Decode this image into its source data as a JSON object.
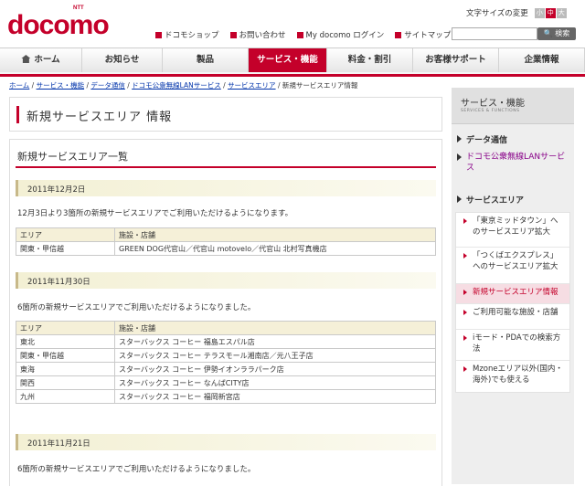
{
  "header": {
    "logo_small": "NTT",
    "logo_text": "docomo",
    "utility_links": [
      "ドコモショップ",
      "お問い合わせ",
      "My docomo ログイン",
      "サイトマップ"
    ],
    "font_size_label": "文字サイズの変更",
    "font_sizes": [
      "小",
      "中",
      "大"
    ],
    "search_placeholder": "",
    "search_button": "検索"
  },
  "nav": {
    "tabs": [
      "ホーム",
      "お知らせ",
      "製品",
      "サービス・機能",
      "料金・割引",
      "お客様サポート",
      "企業情報"
    ],
    "active": "サービス・機能"
  },
  "breadcrumb": {
    "items": [
      "ホーム",
      "サービス・機能",
      "データ通信",
      "ドコモ公衆無線LANサービス",
      "サービスエリア"
    ],
    "current": "新規サービスエリア情報"
  },
  "page_title": "新規サービスエリア 情報",
  "list_title": "新規サービスエリア一覧",
  "entries": [
    {
      "date": "2011年12月2日",
      "intro": "12月3日より3箇所の新規サービスエリアでご利用いただけるようになります。",
      "headers": [
        "エリア",
        "施設・店舗"
      ],
      "rows": [
        [
          "関東・甲信越",
          "GREEN DOG代官山／代官山 motovelo／代官山 北村写真機店"
        ]
      ]
    },
    {
      "date": "2011年11月30日",
      "intro": "6箇所の新規サービスエリアでご利用いただけるようになりました。",
      "headers": [
        "エリア",
        "施設・店舗"
      ],
      "rows": [
        [
          "東北",
          "スターバックス コーヒー 福島エスパル店"
        ],
        [
          "関東・甲信越",
          "スターバックス コーヒー テラスモール湘南店／元八王子店"
        ],
        [
          "東海",
          "スターバックス コーヒー 伊勢イオンララパーク店"
        ],
        [
          "関西",
          "スターバックス コーヒー なんばCITY店"
        ],
        [
          "九州",
          "スターバックス コーヒー 福岡新宮店"
        ]
      ]
    },
    {
      "date": "2011年11月21日",
      "intro": "6箇所の新規サービスエリアでご利用いただけるようになりました。"
    }
  ],
  "sidebar": {
    "title": "サービス・機能",
    "subtitle": "SERVICES & FUNCTIONS",
    "cat1": "データ通信",
    "cat1_link": "ドコモ公衆無線LANサービス",
    "cat2": "サービスエリア",
    "links": [
      "「東京ミッドタウン」へのサービスエリア拡大",
      "「つくばエクスプレス」へのサービスエリア拡大",
      "新規サービスエリア情報",
      "ご利用可能な施設・店舗",
      "iモード・PDAでの検索方法",
      "Mzoneエリア以外(国内・海外)でも使える"
    ],
    "current_index": 2
  },
  "colors": {
    "brand": "#c4002a"
  }
}
